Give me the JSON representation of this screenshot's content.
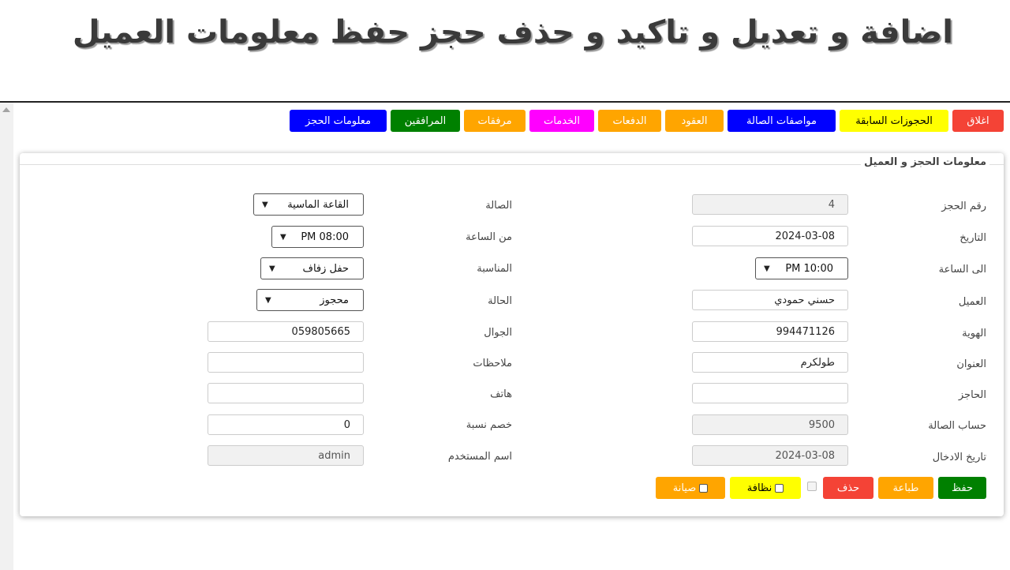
{
  "banner": {
    "title": "اضافة و تعديل و تاكيد و حذف حجز حفظ معلومات العميل"
  },
  "tabs": [
    {
      "label": "معلومات الحجز",
      "bg": "#0000ff",
      "fg": "#ffffff"
    },
    {
      "label": "المرافقين",
      "bg": "#008000",
      "fg": "#ffffff"
    },
    {
      "label": "مرفقات",
      "bg": "#ffa500",
      "fg": "#ffffff"
    },
    {
      "label": "الخدمات",
      "bg": "#ff00ff",
      "fg": "#ffffff"
    },
    {
      "label": "الدفعات",
      "bg": "#ffa500",
      "fg": "#ffffff"
    },
    {
      "label": "العقود",
      "bg": "#ffa500",
      "fg": "#ffffff"
    },
    {
      "label": "مواصفات الصالة",
      "bg": "#0000ff",
      "fg": "#ffffff"
    },
    {
      "label": "الحجوزات السابقة",
      "bg": "#ffff00",
      "fg": "#000000"
    },
    {
      "label": "اغلاق",
      "bg": "#f44336",
      "fg": "#ffffff"
    }
  ],
  "section": {
    "title": "معلومات الحجز و العميل"
  },
  "form": {
    "booking_no": {
      "label": "رقم الحجز",
      "value": "4"
    },
    "date": {
      "label": "التاريخ",
      "value": "2024-03-08"
    },
    "to_time": {
      "label": "الى الساعة",
      "value": "PM 10:00"
    },
    "customer": {
      "label": "العميل",
      "value": "حسني حمودي"
    },
    "id_no": {
      "label": "الهوية",
      "value": "994471126"
    },
    "address": {
      "label": "العنوان",
      "value": "طولكرم"
    },
    "booker": {
      "label": "الحاجز",
      "value": ""
    },
    "hall_account": {
      "label": "حساب الصالة",
      "value": "9500"
    },
    "entry_date": {
      "label": "تاريخ الادخال",
      "value": "2024-03-08"
    },
    "hall": {
      "label": "الصالة",
      "value": "القاعة الماسية"
    },
    "from_time": {
      "label": "من الساعة",
      "value": "PM 08:00"
    },
    "occasion": {
      "label": "المناسبة",
      "value": "حفل زفاف"
    },
    "status": {
      "label": "الحالة",
      "value": "محجوز"
    },
    "mobile": {
      "label": "الجوال",
      "value": "059805665"
    },
    "notes": {
      "label": "ملاحظات",
      "value": ""
    },
    "phone": {
      "label": "هاتف",
      "value": ""
    },
    "discount": {
      "label": "خصم نسبة",
      "value": "0"
    },
    "username": {
      "label": "اسم المستخدم",
      "value": "admin"
    }
  },
  "actions": {
    "save": "حفظ",
    "print": "طباعة",
    "delete": "حذف",
    "cleaning": "نظافة",
    "maintenance": "صيانة"
  },
  "colors": {
    "save": "#008000",
    "print": "#ffa500",
    "delete": "#f44336",
    "cleaning": "#ffff00",
    "maintenance": "#ffa500"
  }
}
